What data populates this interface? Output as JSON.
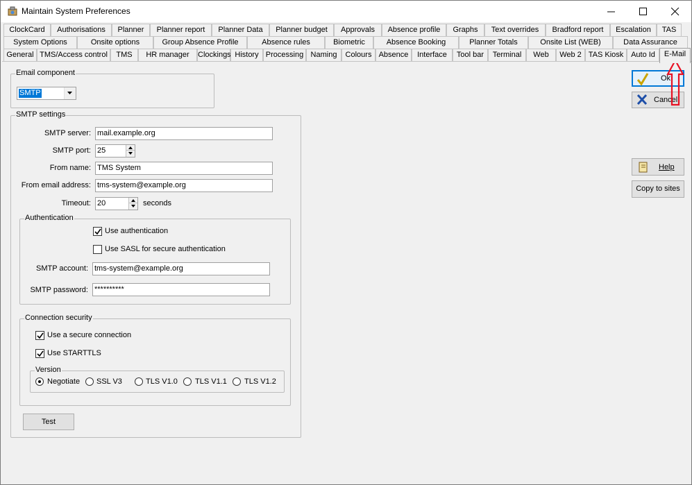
{
  "window": {
    "title": "Maintain System Preferences"
  },
  "tabs": {
    "row1": [
      "ClockCard",
      "Authorisations",
      "Planner",
      "Planner report",
      "Planner Data",
      "Planner budget",
      "Approvals",
      "Absence profile",
      "Graphs",
      "Text overrides",
      "Bradford report",
      "Escalation",
      "TAS"
    ],
    "row2": [
      "System Options",
      "Onsite options",
      "Group Absence Profile",
      "Absence rules",
      "Biometric",
      "Absence Booking",
      "Planner Totals",
      "Onsite List (WEB)",
      "Data Assurance"
    ],
    "row3": [
      "General",
      "TMS/Access control",
      "TMS",
      "HR manager",
      "Clockings",
      "History",
      "Processing",
      "Naming",
      "Colours",
      "Absence",
      "Interface",
      "Tool bar",
      "Terminal",
      "Web",
      "Web 2",
      "TAS Kiosk",
      "Auto Id",
      "E-Mail"
    ],
    "active": "E-Mail"
  },
  "email_component": {
    "legend": "Email component",
    "selected": "SMTP"
  },
  "smtp": {
    "legend": "SMTP settings",
    "server_label": "SMTP server:",
    "server_value": "mail.example.org",
    "port_label": "SMTP port:",
    "port_value": "25",
    "from_name_label": "From name:",
    "from_name_value": "TMS System",
    "from_email_label": "From email address:",
    "from_email_value": "tms-system@example.org",
    "timeout_label": "Timeout:",
    "timeout_value": "20",
    "timeout_unit": "seconds"
  },
  "auth": {
    "legend": "Authentication",
    "use_auth_label": "Use authentication",
    "use_auth": true,
    "use_sasl_label": "Use SASL for secure authentication",
    "use_sasl": false,
    "account_label": "SMTP account:",
    "account_value": "tms-system@example.org",
    "password_label": "SMTP password:",
    "password_value": "**********"
  },
  "security": {
    "legend": "Connection security",
    "secure_label": "Use a secure connection",
    "secure": true,
    "starttls_label": "Use STARTTLS",
    "starttls": true,
    "version_legend": "Version",
    "versions": [
      "Negotiate",
      "SSL V3",
      "TLS V1.0",
      "TLS V1.1",
      "TLS V1.2"
    ],
    "selected_version": "Negotiate"
  },
  "buttons": {
    "ok": "Ok",
    "cancel": "Cancel",
    "help": "Help",
    "copy": "Copy to sites",
    "test": "Test"
  },
  "colors": {
    "annotation_arrow": "#e81123",
    "accent": "#0078d7"
  }
}
